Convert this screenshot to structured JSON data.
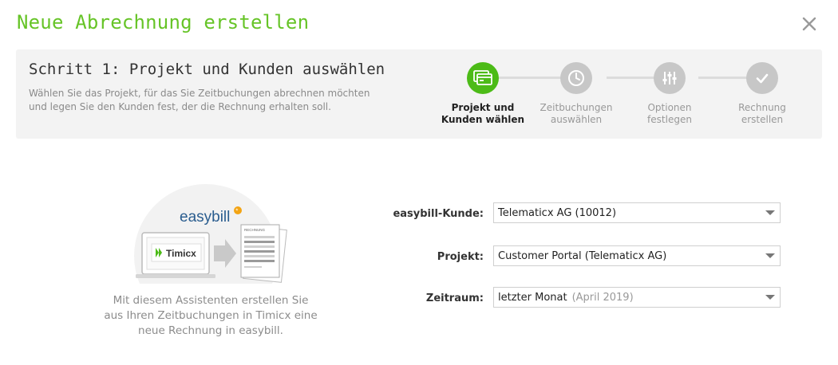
{
  "dialog": {
    "title": "Neue Abrechnung erstellen",
    "close_label": "×"
  },
  "step": {
    "title": "Schritt 1: Projekt und Kunden auswählen",
    "description": "Wählen Sie das Projekt, für das Sie Zeitbuchungen abrechnen möchten und legen Sie den Kunden fest, der die Rechnung erhalten soll."
  },
  "wizard": {
    "steps": [
      {
        "label_line1": "Projekt und",
        "label_line2": "Kunden wählen",
        "icon": "invoice-cards-icon",
        "active": true
      },
      {
        "label_line1": "Zeitbuchungen",
        "label_line2": "auswählen",
        "icon": "clock-icon",
        "active": false
      },
      {
        "label_line1": "Optionen",
        "label_line2": "festlegen",
        "icon": "sliders-icon",
        "active": false
      },
      {
        "label_line1": "Rechnung",
        "label_line2": "erstellen",
        "icon": "checkmark-icon",
        "active": false
      }
    ]
  },
  "illustration": {
    "logo_text": "easybill",
    "app_name": "Timicx",
    "document_header": "RECHNUNG"
  },
  "intro": {
    "text": "Mit diesem Assistenten erstellen Sie aus Ihren Zeitbuchungen in Timicx eine neue Rechnung in easybill."
  },
  "form": {
    "customer": {
      "label": "easybill-Kunde:",
      "value": "Telematicx AG (10012)"
    },
    "project": {
      "label": "Projekt:",
      "value": "Customer Portal (Telematicx AG)"
    },
    "period": {
      "label": "Zeitraum:",
      "value": "letzter Monat",
      "hint": "(April 2019)"
    }
  },
  "colors": {
    "accent": "#66c427",
    "active_step": "#4cbb17",
    "inactive_step": "#c7c7c7",
    "panel_bg": "#f3f3f3"
  }
}
